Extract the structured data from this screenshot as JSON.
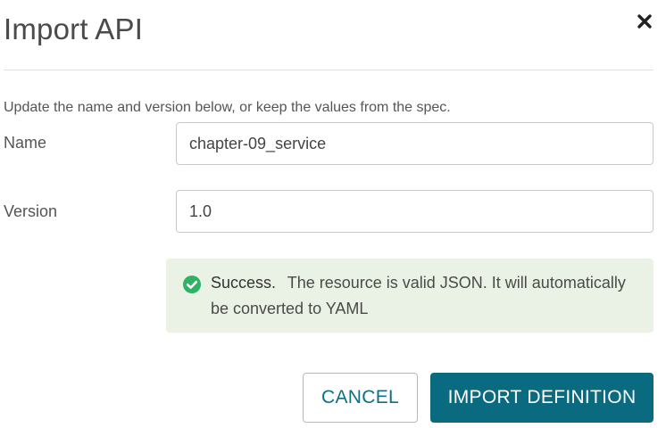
{
  "dialog": {
    "title": "Import API",
    "close_icon": "close-icon"
  },
  "intro_text": "Update the name and version below, or keep the values from the spec.",
  "form": {
    "name_label": "Name",
    "name_value": "chapter-09_service",
    "version_label": "Version",
    "version_value": "1.0"
  },
  "alert": {
    "icon": "check-circle-icon",
    "title": "Success.",
    "message": "The resource is valid JSON. It will automatically be converted to YAML"
  },
  "buttons": {
    "cancel_label": "CANCEL",
    "import_label": "IMPORT DEFINITION"
  },
  "colors": {
    "primary": "#0a6a80",
    "success": "#2fb266",
    "success_bg": "#eaf2e5"
  }
}
